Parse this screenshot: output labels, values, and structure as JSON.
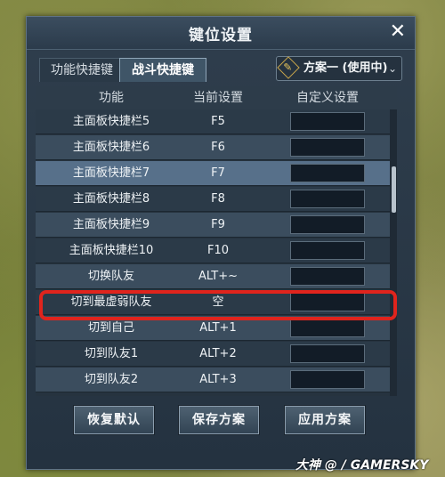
{
  "dialog": {
    "title": "键位设置",
    "close_symbol": "✕"
  },
  "tabs": [
    {
      "label": "功能快捷键",
      "active": false
    },
    {
      "label": "战斗快捷键",
      "active": true
    }
  ],
  "scheme": {
    "label": "方案一 (使用中)",
    "edit_icon": "pencil-edit-icon",
    "caret": "⌄"
  },
  "columns": [
    "功能",
    "当前设置",
    "自定义设置"
  ],
  "rows": [
    {
      "function": "主面板快捷栏5",
      "current": "F5",
      "custom": ""
    },
    {
      "function": "主面板快捷栏6",
      "current": "F6",
      "custom": ""
    },
    {
      "function": "主面板快捷栏7",
      "current": "F7",
      "custom": ""
    },
    {
      "function": "主面板快捷栏8",
      "current": "F8",
      "custom": ""
    },
    {
      "function": "主面板快捷栏9",
      "current": "F9",
      "custom": ""
    },
    {
      "function": "主面板快捷栏10",
      "current": "F10",
      "custom": ""
    },
    {
      "function": "切换队友",
      "current": "ALT+~",
      "custom": ""
    },
    {
      "function": "切到最虚弱队友",
      "current": "空",
      "custom": ""
    },
    {
      "function": "切到自己",
      "current": "ALT+1",
      "custom": ""
    },
    {
      "function": "切到队友1",
      "current": "ALT+2",
      "custom": ""
    },
    {
      "function": "切到队友2",
      "current": "ALT+3",
      "custom": ""
    }
  ],
  "buttons": {
    "restore": "恢复默认",
    "save": "保存方案",
    "apply": "应用方案"
  },
  "watermark": "大神 @ / GAMERSKY",
  "colors": {
    "highlight": "#e0241d",
    "panel": "#2f3e4d",
    "selected_row": "#57708a"
  }
}
